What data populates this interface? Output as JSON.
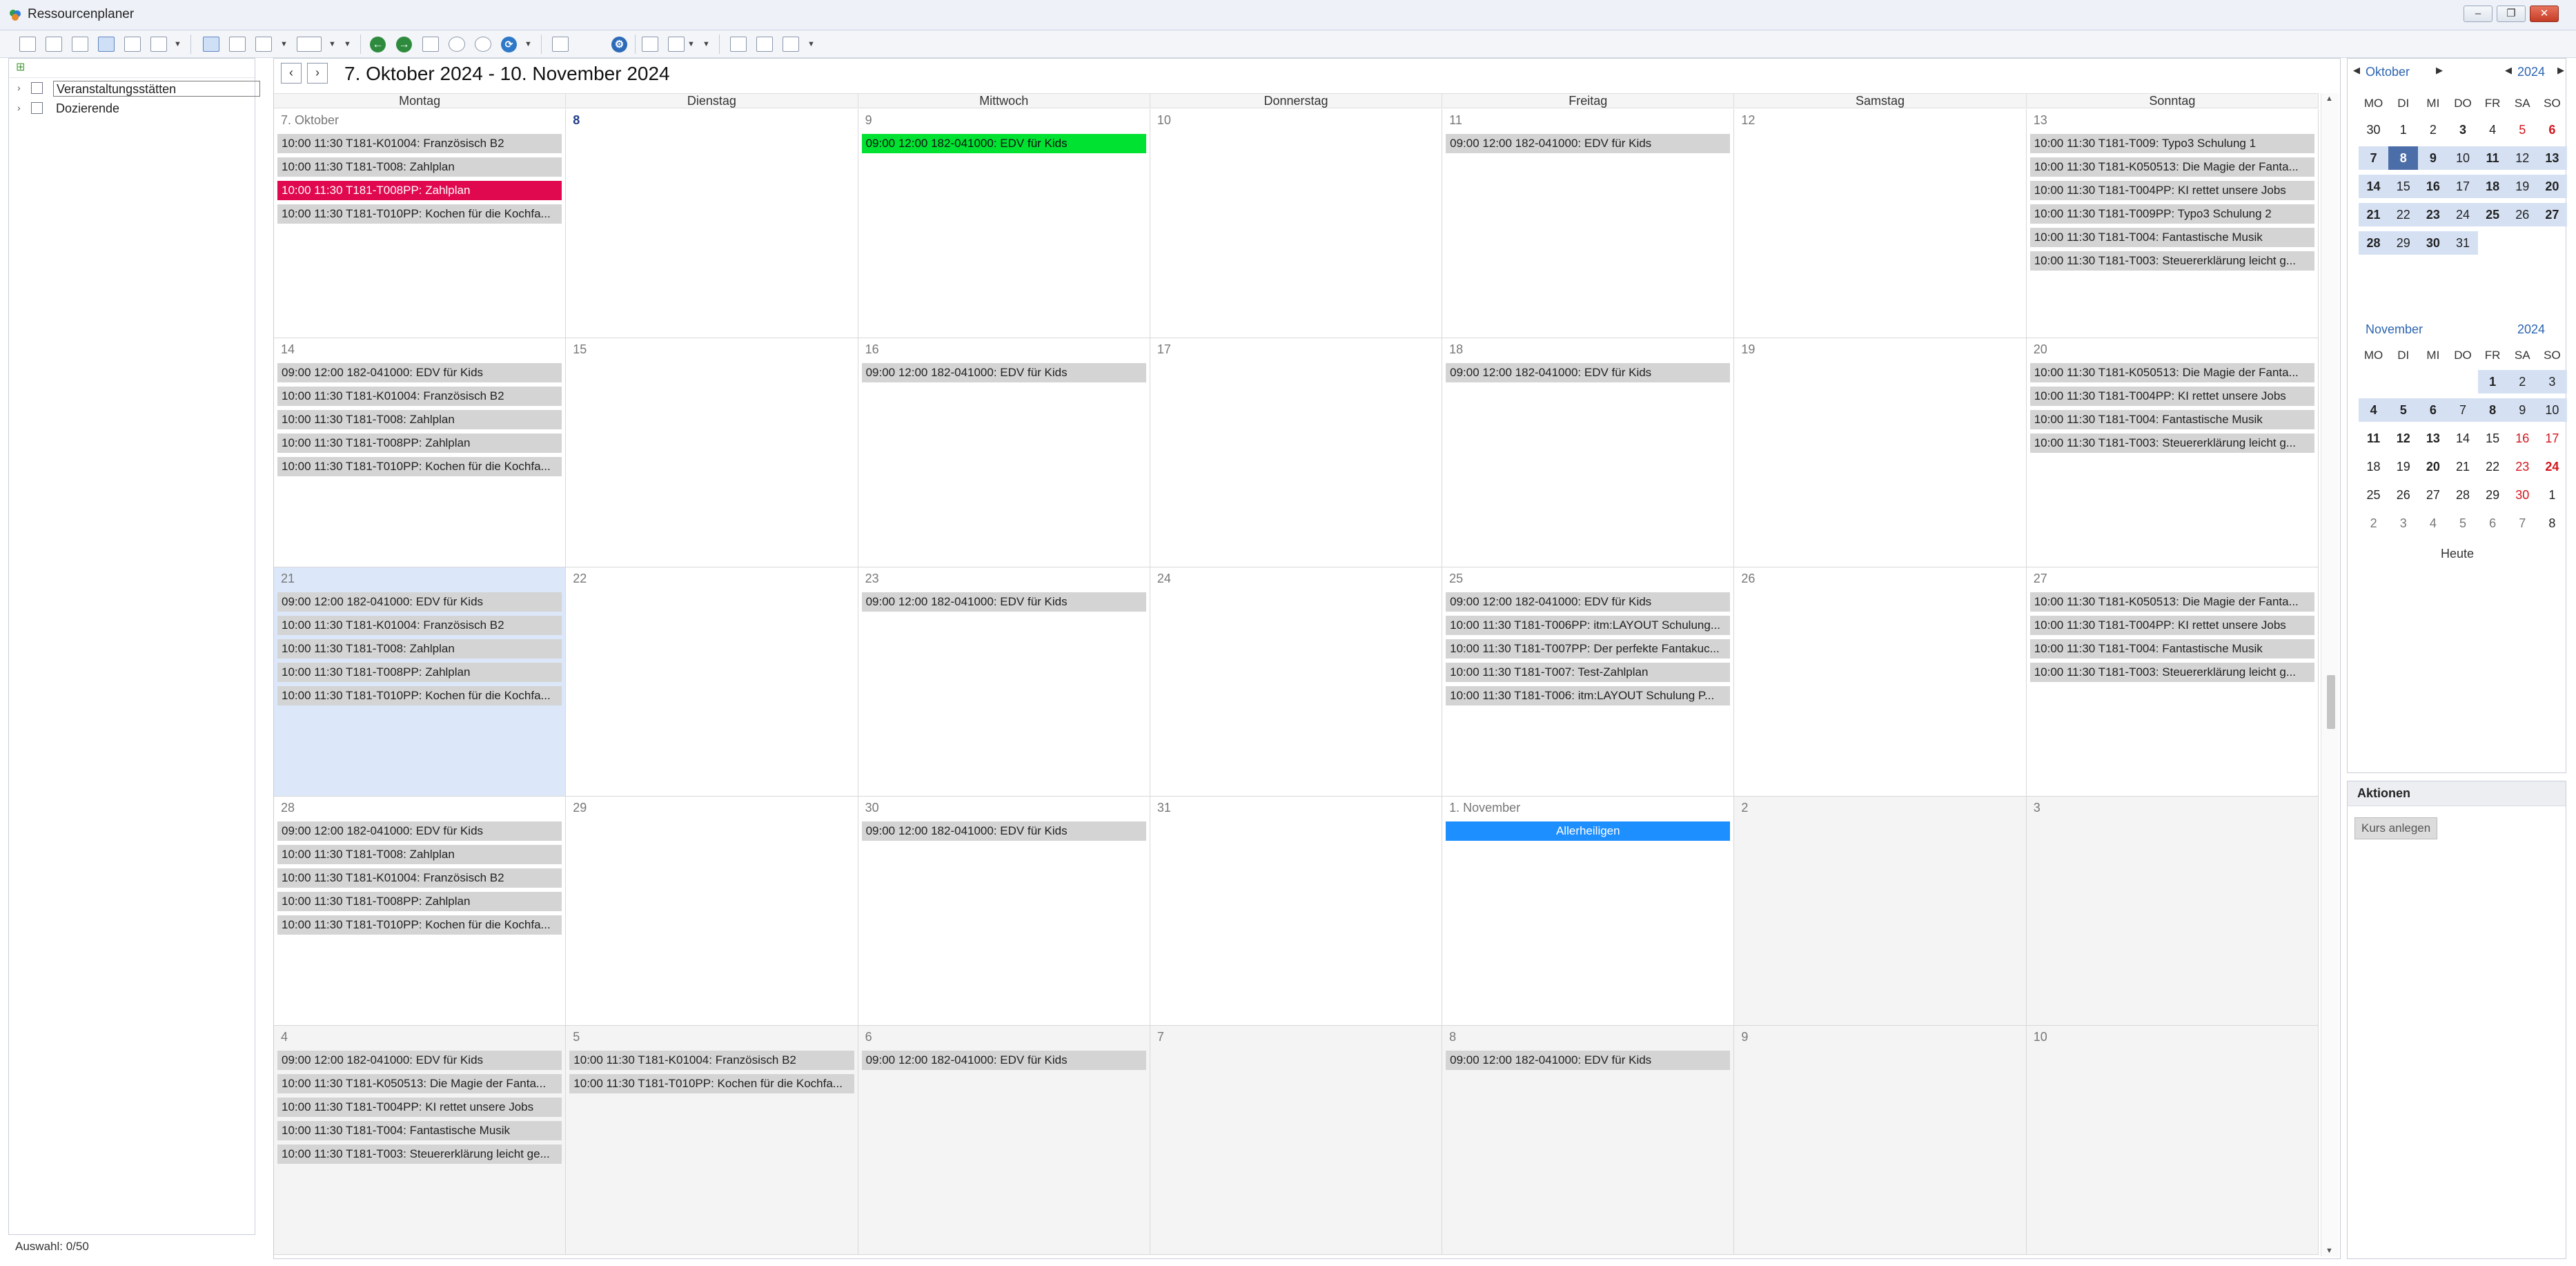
{
  "window": {
    "title": "Ressourcenplaner",
    "minimize": "‒",
    "restore": "❐",
    "close": "✕"
  },
  "left_pane": {
    "tree": [
      {
        "label": "Veranstaltungsstätten"
      },
      {
        "label": "Dozierende"
      }
    ],
    "status": "Auswahl: 0/50"
  },
  "calendar": {
    "prev": "‹",
    "next": "›",
    "range_title": "7. Oktober 2024 - 10. November 2024",
    "weekdays": [
      "Montag",
      "Dienstag",
      "Mittwoch",
      "Donnerstag",
      "Freitag",
      "Samstag",
      "Sonntag"
    ],
    "weeks": [
      [
        {
          "date": "7. Oktober",
          "events": [
            {
              "text": "10:00 11:30 T181-K01004: Französisch B2"
            },
            {
              "text": "10:00 11:30 T181-T008: Zahlplan"
            },
            {
              "text": "10:00 11:30 T181-T008PP: Zahlplan",
              "color": "#e0084f"
            },
            {
              "text": "10:00 11:30 T181-T010PP: Kochen für die Kochfa..."
            }
          ]
        },
        {
          "date": "8",
          "bold": true,
          "events": []
        },
        {
          "date": "9",
          "events": [
            {
              "text": "09:00 12:00 182-041000: EDV für Kids",
              "color": "#00e232"
            }
          ]
        },
        {
          "date": "10",
          "events": []
        },
        {
          "date": "11",
          "events": [
            {
              "text": "09:00 12:00 182-041000: EDV für Kids"
            }
          ]
        },
        {
          "date": "12",
          "events": []
        },
        {
          "date": "13",
          "events": [
            {
              "text": "10:00 11:30 T181-T009: Typo3 Schulung 1"
            },
            {
              "text": "10:00 11:30 T181-K050513: Die Magie der Fanta..."
            },
            {
              "text": "10:00 11:30 T181-T004PP: KI rettet unsere Jobs"
            },
            {
              "text": "10:00 11:30 T181-T009PP: Typo3 Schulung 2"
            },
            {
              "text": "10:00 11:30 T181-T004: Fantastische Musik"
            },
            {
              "text": "10:00 11:30 T181-T003: Steuererklärung leicht g..."
            }
          ]
        }
      ],
      [
        {
          "date": "14",
          "events": [
            {
              "text": "09:00 12:00 182-041000: EDV für Kids"
            },
            {
              "text": "10:00 11:30 T181-K01004: Französisch B2"
            },
            {
              "text": "10:00 11:30 T181-T008: Zahlplan"
            },
            {
              "text": "10:00 11:30 T181-T008PP: Zahlplan"
            },
            {
              "text": "10:00 11:30 T181-T010PP: Kochen für die Kochfa..."
            }
          ]
        },
        {
          "date": "15",
          "events": []
        },
        {
          "date": "16",
          "events": [
            {
              "text": "09:00 12:00 182-041000: EDV für Kids"
            }
          ]
        },
        {
          "date": "17",
          "events": []
        },
        {
          "date": "18",
          "events": [
            {
              "text": "09:00 12:00 182-041000: EDV für Kids"
            }
          ]
        },
        {
          "date": "19",
          "events": []
        },
        {
          "date": "20",
          "events": [
            {
              "text": "10:00 11:30 T181-K050513: Die Magie der Fanta..."
            },
            {
              "text": "10:00 11:30 T181-T004PP: KI rettet unsere Jobs"
            },
            {
              "text": "10:00 11:30 T181-T004: Fantastische Musik"
            },
            {
              "text": "10:00 11:30 T181-T003: Steuererklärung leicht g..."
            }
          ]
        }
      ],
      [
        {
          "date": "21",
          "today": true,
          "events": [
            {
              "text": "09:00 12:00 182-041000: EDV für Kids"
            },
            {
              "text": "10:00 11:30 T181-K01004: Französisch B2"
            },
            {
              "text": "10:00 11:30 T181-T008: Zahlplan"
            },
            {
              "text": "10:00 11:30 T181-T008PP: Zahlplan"
            },
            {
              "text": "10:00 11:30 T181-T010PP: Kochen für die Kochfa..."
            }
          ]
        },
        {
          "date": "22",
          "events": []
        },
        {
          "date": "23",
          "events": [
            {
              "text": "09:00 12:00 182-041000: EDV für Kids"
            }
          ]
        },
        {
          "date": "24",
          "events": []
        },
        {
          "date": "25",
          "events": [
            {
              "text": "09:00 12:00 182-041000: EDV für Kids"
            },
            {
              "text": "10:00 11:30 T181-T006PP: itm:LAYOUT Schulung..."
            },
            {
              "text": "10:00 11:30 T181-T007PP: Der perfekte Fantakuc..."
            },
            {
              "text": "10:00 11:30 T181-T007: Test-Zahlplan"
            },
            {
              "text": "10:00 11:30 T181-T006: itm:LAYOUT Schulung P..."
            }
          ]
        },
        {
          "date": "26",
          "events": []
        },
        {
          "date": "27",
          "events": [
            {
              "text": "10:00 11:30 T181-K050513: Die Magie der Fanta..."
            },
            {
              "text": "10:00 11:30 T181-T004PP: KI rettet unsere Jobs"
            },
            {
              "text": "10:00 11:30 T181-T004: Fantastische Musik"
            },
            {
              "text": "10:00 11:30 T181-T003: Steuererklärung leicht g..."
            }
          ]
        }
      ],
      [
        {
          "date": "28",
          "events": [
            {
              "text": "09:00 12:00 182-041000: EDV für Kids"
            },
            {
              "text": "10:00 11:30 T181-T008: Zahlplan"
            },
            {
              "text": "10:00 11:30 T181-K01004: Französisch B2"
            },
            {
              "text": "10:00 11:30 T181-T008PP: Zahlplan"
            },
            {
              "text": "10:00 11:30 T181-T010PP: Kochen für die Kochfa..."
            }
          ]
        },
        {
          "date": "29",
          "events": []
        },
        {
          "date": "30",
          "events": [
            {
              "text": "09:00 12:00 182-041000: EDV für Kids"
            }
          ]
        },
        {
          "date": "31",
          "events": []
        },
        {
          "date": "1. November",
          "events": [
            {
              "text": "Allerheiligen",
              "color": "#1e8fff",
              "center": true
            }
          ]
        },
        {
          "date": "2",
          "other": true,
          "events": []
        },
        {
          "date": "3",
          "other": true,
          "events": []
        }
      ],
      [
        {
          "date": "4",
          "other": true,
          "events": [
            {
              "text": "09:00 12:00 182-041000: EDV für Kids"
            },
            {
              "text": "10:00 11:30 T181-K050513: Die Magie der Fanta..."
            },
            {
              "text": "10:00 11:30 T181-T004PP: KI rettet unsere Jobs"
            },
            {
              "text": "10:00 11:30 T181-T004: Fantastische Musik"
            },
            {
              "text": "10:00 11:30 T181-T003: Steuererklärung leicht ge..."
            }
          ]
        },
        {
          "date": "5",
          "other": true,
          "events": [
            {
              "text": "10:00 11:30 T181-K01004: Französisch B2"
            },
            {
              "text": "10:00 11:30 T181-T010PP: Kochen für die Kochfa..."
            }
          ]
        },
        {
          "date": "6",
          "other": true,
          "events": [
            {
              "text": "09:00 12:00 182-041000: EDV für Kids"
            }
          ]
        },
        {
          "date": "7",
          "other": true,
          "events": []
        },
        {
          "date": "8",
          "other": true,
          "events": [
            {
              "text": "09:00 12:00 182-041000: EDV für Kids"
            }
          ]
        },
        {
          "date": "9",
          "other": true,
          "events": []
        },
        {
          "date": "10",
          "other": true,
          "events": []
        }
      ]
    ]
  },
  "mini_calendars": [
    {
      "month": "Oktober",
      "year": "2024",
      "days_header": [
        "MO",
        "DI",
        "MI",
        "DO",
        "FR",
        "SA",
        "SO"
      ],
      "rows": [
        {
          "days": [
            {
              "d": "30"
            },
            {
              "d": "1"
            },
            {
              "d": "2"
            },
            {
              "d": "3",
              "b": 1
            },
            {
              "d": "4"
            },
            {
              "d": "5",
              "red": 1
            },
            {
              "d": "6",
              "red": 1,
              "b": 1
            }
          ]
        },
        {
          "days": [
            {
              "d": "7",
              "in": 1,
              "b": 1
            },
            {
              "d": "8",
              "sel": 1
            },
            {
              "d": "9",
              "in": 1,
              "b": 1
            },
            {
              "d": "10",
              "in": 1
            },
            {
              "d": "11",
              "in": 1,
              "b": 1
            },
            {
              "d": "12",
              "in": 1
            },
            {
              "d": "13",
              "in": 1,
              "b": 1
            }
          ]
        },
        {
          "days": [
            {
              "d": "14",
              "in": 1,
              "b": 1
            },
            {
              "d": "15",
              "in": 1
            },
            {
              "d": "16",
              "in": 1,
              "b": 1
            },
            {
              "d": "17",
              "in": 1
            },
            {
              "d": "18",
              "in": 1,
              "b": 1
            },
            {
              "d": "19",
              "in": 1
            },
            {
              "d": "20",
              "in": 1,
              "b": 1
            }
          ]
        },
        {
          "days": [
            {
              "d": "21",
              "in": 1,
              "b": 1
            },
            {
              "d": "22",
              "in": 1
            },
            {
              "d": "23",
              "in": 1,
              "b": 1
            },
            {
              "d": "24",
              "in": 1
            },
            {
              "d": "25",
              "in": 1,
              "b": 1
            },
            {
              "d": "26",
              "in": 1
            },
            {
              "d": "27",
              "in": 1,
              "b": 1
            }
          ]
        },
        {
          "days": [
            {
              "d": "28",
              "in": 1,
              "b": 1
            },
            {
              "d": "29",
              "in": 1
            },
            {
              "d": "30",
              "in": 1,
              "b": 1
            },
            {
              "d": "31",
              "in": 1
            },
            {
              "d": ""
            },
            {
              "d": ""
            },
            {
              "d": ""
            }
          ]
        }
      ]
    },
    {
      "month": "November",
      "year": "2024",
      "days_header": [
        "MO",
        "DI",
        "MI",
        "DO",
        "FR",
        "SA",
        "SO"
      ],
      "rows": [
        {
          "days": [
            {
              "d": ""
            },
            {
              "d": ""
            },
            {
              "d": ""
            },
            {
              "d": ""
            },
            {
              "d": "1",
              "in": 1,
              "b": 1
            },
            {
              "d": "2",
              "in": 1
            },
            {
              "d": "3",
              "in": 1
            }
          ]
        },
        {
          "days": [
            {
              "d": "4",
              "in": 1,
              "b": 1
            },
            {
              "d": "5",
              "in": 1,
              "b": 1
            },
            {
              "d": "6",
              "in": 1,
              "b": 1
            },
            {
              "d": "7",
              "in": 1
            },
            {
              "d": "8",
              "in": 1,
              "b": 1
            },
            {
              "d": "9",
              "in": 1
            },
            {
              "d": "10",
              "in": 1
            }
          ]
        },
        {
          "days": [
            {
              "d": "11",
              "b": 1
            },
            {
              "d": "12",
              "b": 1
            },
            {
              "d": "13",
              "b": 1
            },
            {
              "d": "14"
            },
            {
              "d": "15"
            },
            {
              "d": "16",
              "red": 1
            },
            {
              "d": "17",
              "red": 1
            }
          ]
        },
        {
          "days": [
            {
              "d": "18"
            },
            {
              "d": "19"
            },
            {
              "d": "20",
              "b": 1
            },
            {
              "d": "21"
            },
            {
              "d": "22"
            },
            {
              "d": "23",
              "red": 1
            },
            {
              "d": "24",
              "red": 1,
              "b": 1
            }
          ]
        },
        {
          "days": [
            {
              "d": "25"
            },
            {
              "d": "26"
            },
            {
              "d": "27"
            },
            {
              "d": "28"
            },
            {
              "d": "29"
            },
            {
              "d": "30",
              "red": 1
            },
            {
              "d": "1"
            }
          ]
        },
        {
          "days": [
            {
              "d": "2",
              "grey": 1
            },
            {
              "d": "3",
              "grey": 1
            },
            {
              "d": "4",
              "grey": 1
            },
            {
              "d": "5",
              "grey": 1
            },
            {
              "d": "6",
              "grey": 1
            },
            {
              "d": "7",
              "grey": 1
            },
            {
              "d": "8"
            }
          ]
        }
      ]
    }
  ],
  "today_label": "Heute",
  "actions": {
    "header": "Aktionen",
    "create_course": "Kurs anlegen"
  },
  "colors": {
    "accent": "#2c64b0",
    "today": "#dce8f9",
    "event": "#d4d4d4"
  }
}
